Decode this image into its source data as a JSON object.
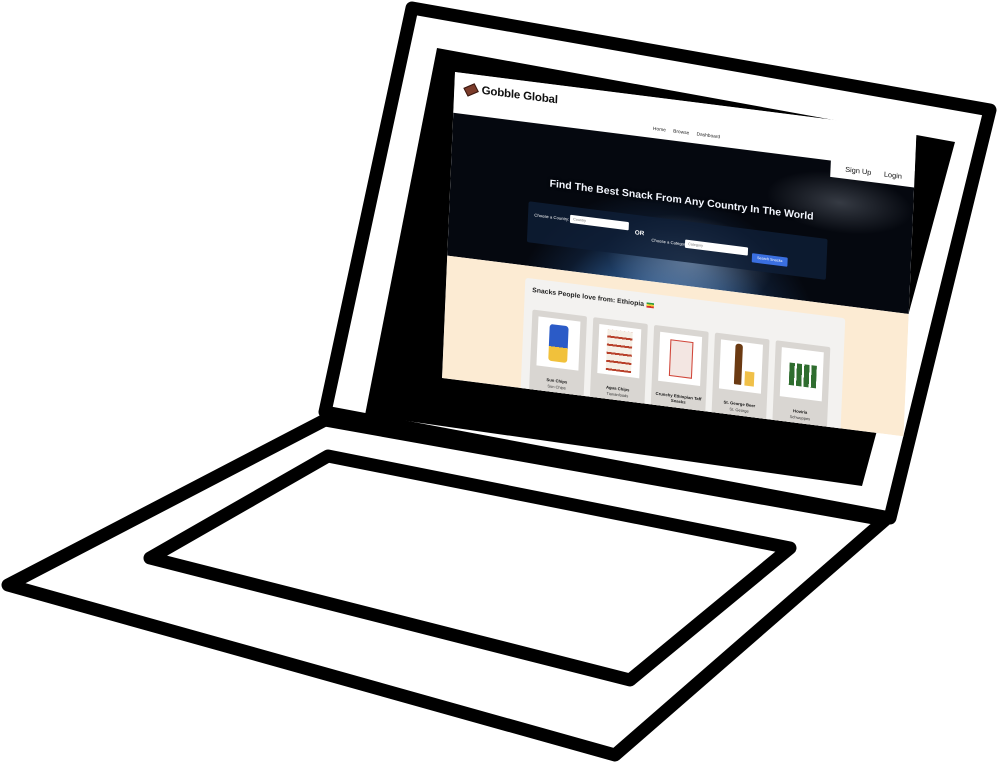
{
  "site": {
    "brand": "Gobble Global",
    "nav": {
      "home": "Home",
      "browse": "Browse",
      "dashboard": "Dashboard"
    },
    "auth": {
      "signup": "Sign Up",
      "login": "Login"
    }
  },
  "hero": {
    "title": "Find The Best Snack From Any Country In The World",
    "search": {
      "country_label": "Choose a Country:",
      "country_placeholder": "Country",
      "or": "OR",
      "category_label": "Choose a Category:",
      "category_placeholder": "Category",
      "button": "Search Snacks"
    }
  },
  "section": {
    "title": "Snacks People love from: Ethiopia",
    "flag_icon": "ethiopia-flag-icon"
  },
  "products": [
    {
      "name": "Sun Chips",
      "brand": "Sun Chips"
    },
    {
      "name": "Agua Chips",
      "brand": "Tiananfoods"
    },
    {
      "name": "Crunchy Ethiopian Taff Snacks",
      "brand": ""
    },
    {
      "name": "St. George Beer",
      "brand": "St. George"
    },
    {
      "name": "Hoviria",
      "brand": "Schweppes"
    }
  ],
  "colors": {
    "section_bg": "#fcebd3",
    "button": "#3a6fe0",
    "hero_dark": "#0d1a2e"
  }
}
